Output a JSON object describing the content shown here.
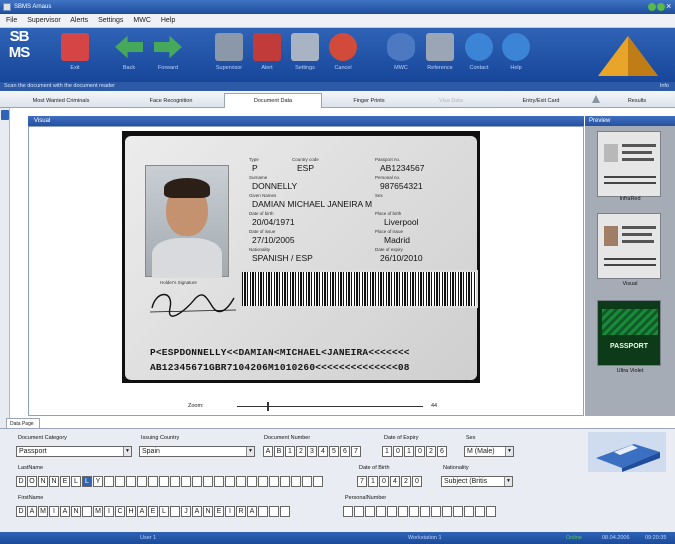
{
  "window": {
    "title": "SBMS Arnaus"
  },
  "menu": [
    "File",
    "Supervisor",
    "Alerts",
    "Settings",
    "MWC",
    "Help"
  ],
  "logo": {
    "line1": "SB",
    "line2": "MS"
  },
  "toolbar": [
    {
      "name": "exit",
      "label": "Exit",
      "icon": "exit-door-icon",
      "color": "#d64545"
    },
    {
      "name": "back",
      "label": "Back",
      "icon": "arrow-left-icon",
      "color": "#45a85a"
    },
    {
      "name": "forward",
      "label": "Forward",
      "icon": "arrow-right-icon",
      "color": "#45a85a"
    },
    {
      "name": "supervisor",
      "label": "Supervisor",
      "icon": "supervisor-icon",
      "color": "#8a98aa"
    },
    {
      "name": "alert",
      "label": "Alert",
      "icon": "alert-icon",
      "color": "#c23b3b"
    },
    {
      "name": "settings",
      "label": "Settings",
      "icon": "settings-icon",
      "color": "#a8b4c4"
    },
    {
      "name": "cancel",
      "label": "Cancel",
      "icon": "cancel-icon",
      "color": "#d24b3a"
    },
    {
      "name": "mwc",
      "label": "MWC",
      "icon": "eye-icon",
      "color": "#4d79c2"
    },
    {
      "name": "reference",
      "label": "Reference",
      "icon": "reference-icon",
      "color": "#9aa6b6"
    },
    {
      "name": "contact",
      "label": "Contact",
      "icon": "contact-icon",
      "color": "#3b84d6"
    },
    {
      "name": "help",
      "label": "Help",
      "icon": "help-icon",
      "color": "#3b84d6"
    }
  ],
  "status_strip": {
    "message": "Scan the document with the document reader",
    "right": "Info"
  },
  "tabs": [
    {
      "label": "Most Wanted Criminals",
      "active": false,
      "disabled": false
    },
    {
      "label": "Face Recognition",
      "active": false,
      "disabled": false
    },
    {
      "label": "Document Data",
      "active": true,
      "disabled": false
    },
    {
      "label": "Finger Prints",
      "active": false,
      "disabled": false
    },
    {
      "label": "Visa Data",
      "active": false,
      "disabled": true
    },
    {
      "label": "Entry/Exit Card",
      "active": false,
      "disabled": false
    },
    {
      "label": "Results",
      "active": false,
      "disabled": false
    }
  ],
  "visual": {
    "header": "Visual",
    "zoom_label": "Zoom:",
    "zoom_value": "44"
  },
  "document": {
    "type_label": "Type",
    "type": "P",
    "country_label": "Country code",
    "country": "ESP",
    "passport_label": "Passport no.",
    "passport": "AB1234567",
    "surname_label": "Surname",
    "surname": "DONNELLY",
    "personal_label": "Personal no.",
    "personal": "987654321",
    "given_label": "Given Names",
    "given": "DAMIAN MICHAEL JANEIRA M",
    "sex_label": "Sex",
    "dob_label": "Date of birth",
    "dob": "20/04/1971",
    "pob_label": "Place of birth",
    "pob": "Liverpool",
    "doi_label": "Date of issue",
    "doi": "27/10/2005",
    "poi_label": "Place of issue",
    "poi": "Madrid",
    "nat_label": "Nationality",
    "nat": "SPANISH / ESP",
    "doe_label": "Date of expiry",
    "doe": "26/10/2010",
    "sig_label": "Holder's Signature",
    "mrz1": "P<ESPDONNELLY<<DAMIAN<MICHAEL<JANEIRA<<<<<<<",
    "mrz2": "AB12345671GBR7104206M1010260<<<<<<<<<<<<<<08"
  },
  "preview": {
    "header": "Preview",
    "items": [
      {
        "caption": "InfraRed"
      },
      {
        "caption": "Visual"
      },
      {
        "caption": "Ultra Violet",
        "banner": "PASSPORT"
      }
    ]
  },
  "data_tab": "Data Page",
  "form": {
    "doc_category_label": "Document Category",
    "doc_category": "Passport",
    "issuing_country_label": "Issuing Country",
    "issuing_country": "Spain",
    "doc_number_label": "Document Number",
    "doc_number": [
      "A",
      "B",
      "1",
      "2",
      "3",
      "4",
      "5",
      "6",
      "7"
    ],
    "expiry_label": "Date of Expiry",
    "expiry": [
      "1",
      "0",
      "1",
      "0",
      "2",
      "6"
    ],
    "sex_label": "Sex",
    "sex": "M (Male)",
    "lastname_label": "LastName",
    "lastname": [
      "D",
      "O",
      "N",
      "N",
      "E",
      "L",
      "L",
      "Y",
      "",
      "",
      "",
      "",
      "",
      "",
      "",
      "",
      "",
      "",
      "",
      "",
      "",
      "",
      "",
      "",
      "",
      "",
      "",
      ""
    ],
    "dob_label": "Date of Birth",
    "dob": [
      "7",
      "1",
      "0",
      "4",
      "2",
      "0"
    ],
    "nationality_label": "Nationality",
    "nationality": "Subject (Britis",
    "firstname_label": "FirstName",
    "firstname": [
      "D",
      "A",
      "M",
      "I",
      "A",
      "N",
      "",
      "M",
      "I",
      "C",
      "H",
      "A",
      "E",
      "L",
      "",
      "J",
      "A",
      "N",
      "E",
      "I",
      "R",
      "A",
      "",
      "",
      ""
    ],
    "personal_label": "PersonalNumber",
    "personal": [
      "",
      "",
      "",
      "",
      "",
      "",
      "",
      "",
      "",
      "",
      "",
      "",
      "",
      ""
    ]
  },
  "bottom": {
    "user": "User 1",
    "workstation": "Workstation 1",
    "online": "Online",
    "date": "08.04.2006",
    "time": "09:20:35"
  }
}
